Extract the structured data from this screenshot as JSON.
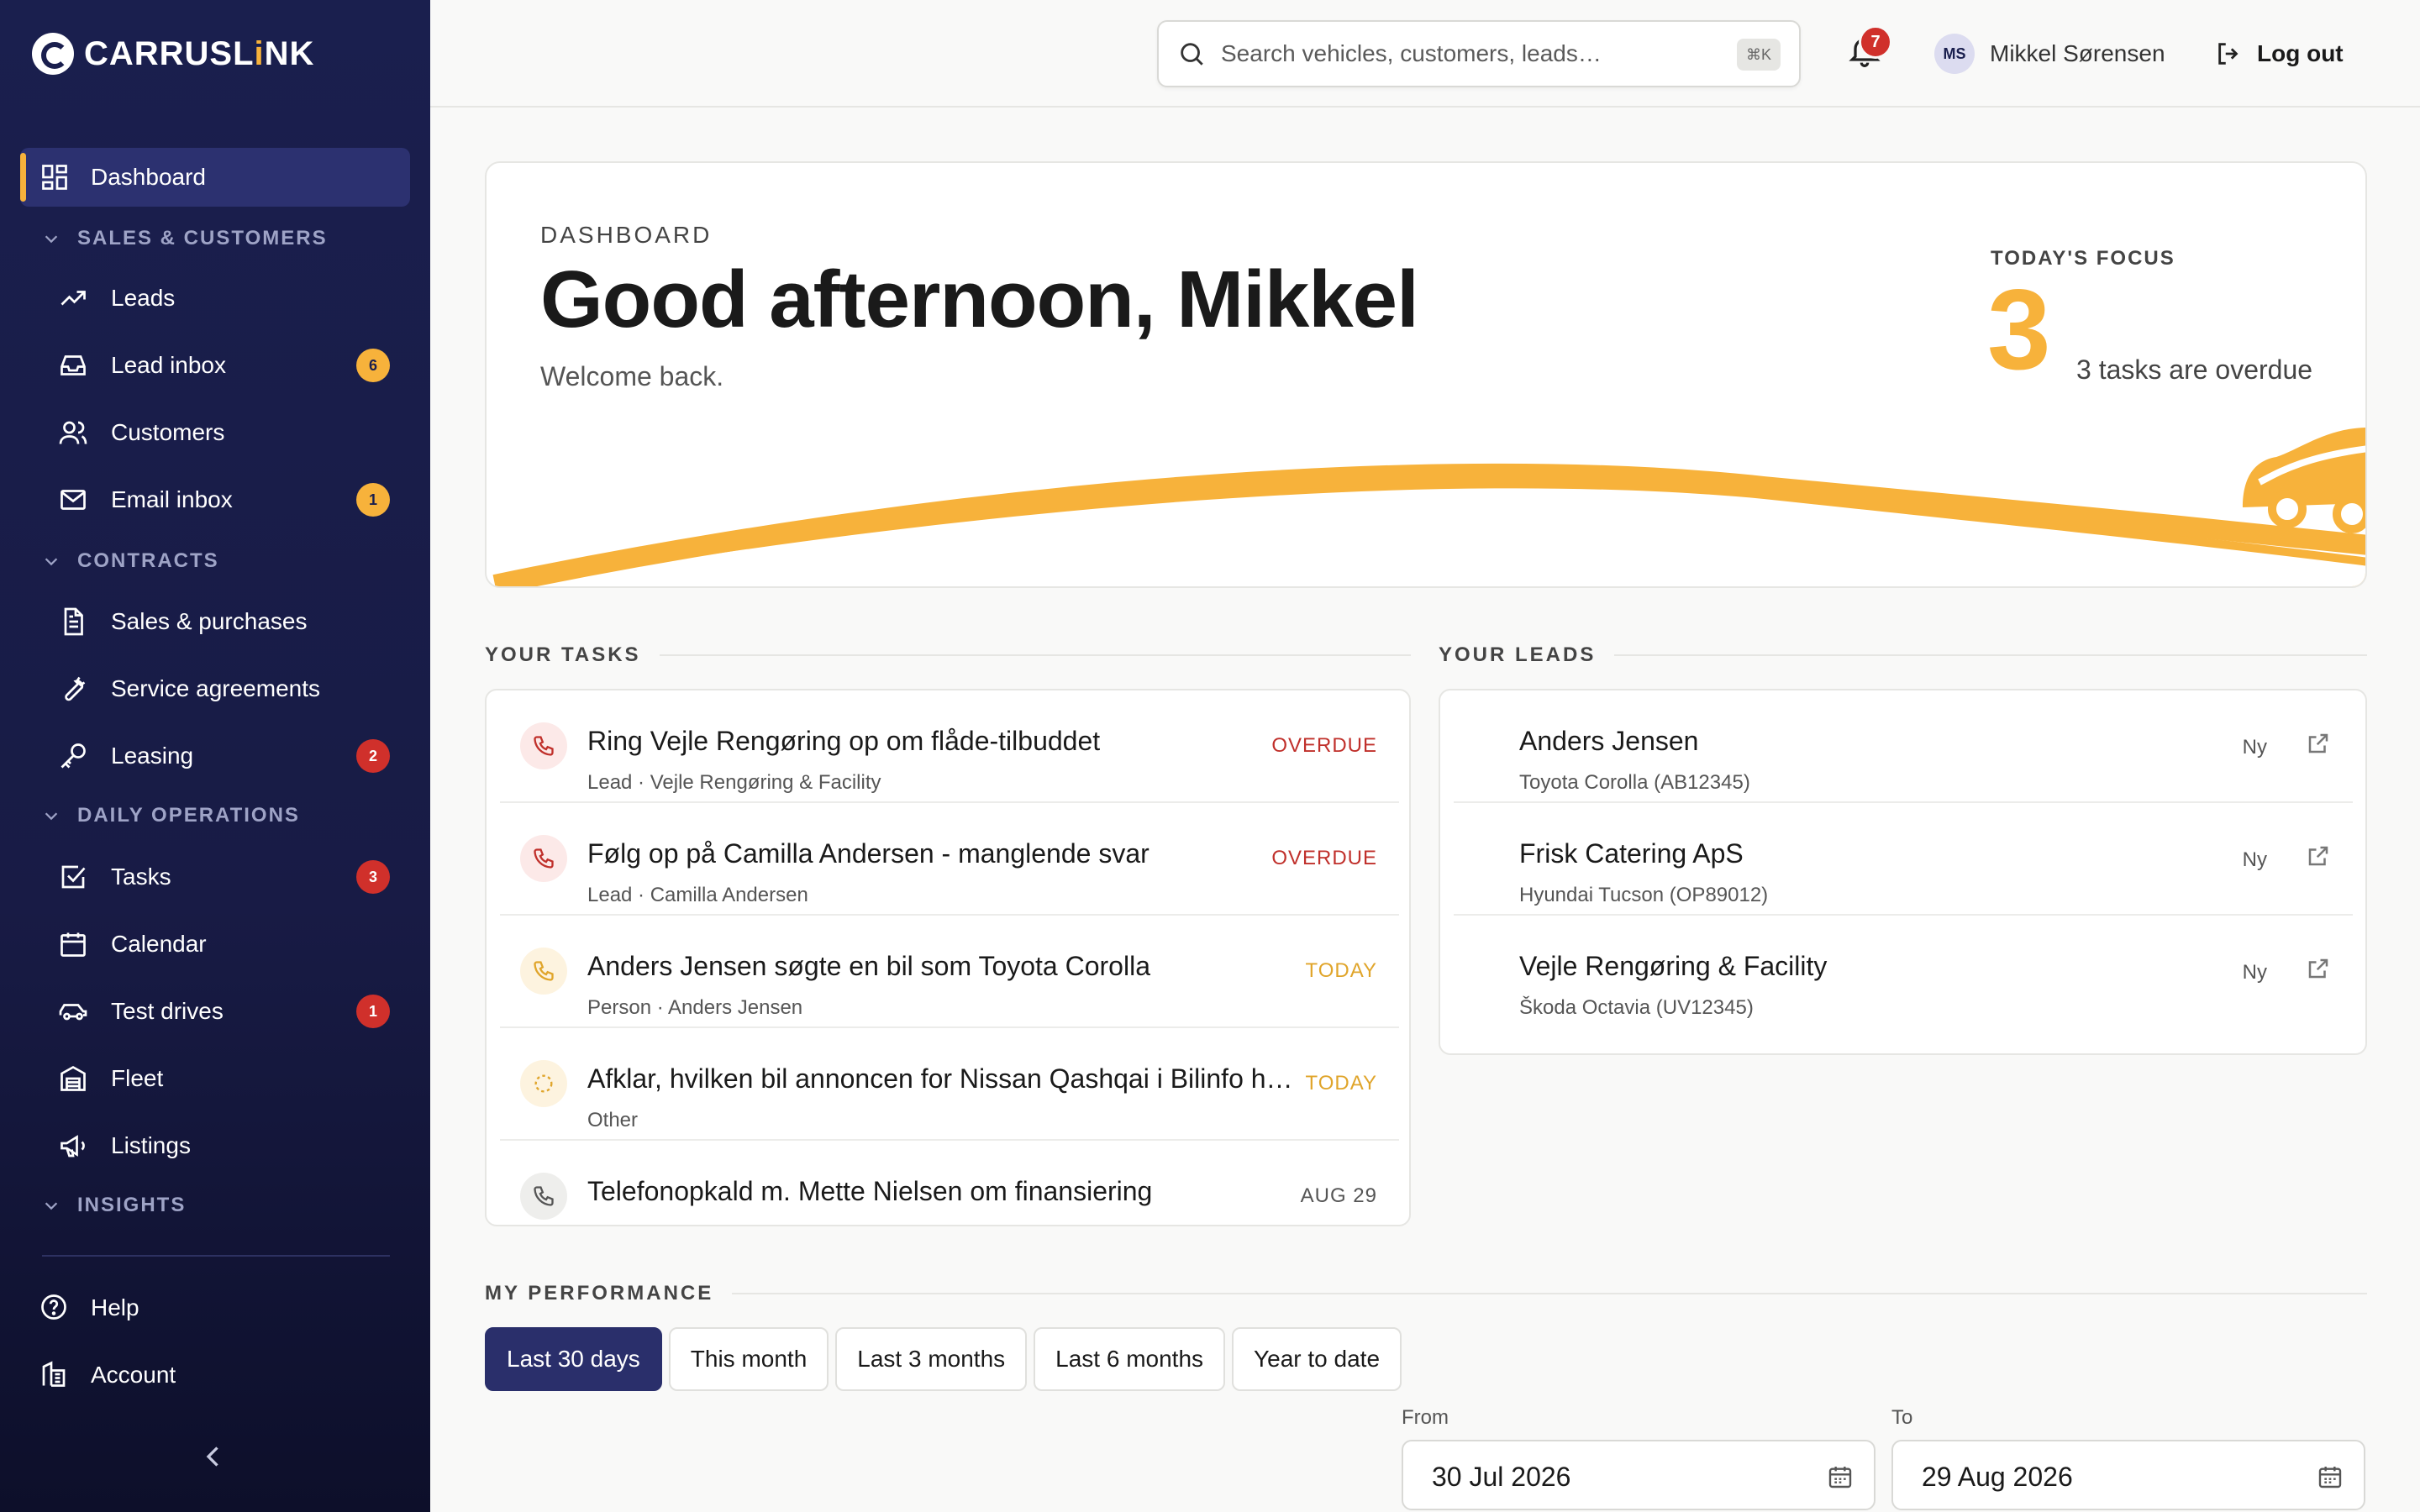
{
  "brand": {
    "name_prefix": "CARRUSL",
    "name_i": "i",
    "name_suffix": "NK"
  },
  "sidebar": {
    "dashboard": "Dashboard",
    "sections": {
      "sales": "SALES & CUSTOMERS",
      "contracts": "CONTRACTS",
      "daily": "DAILY OPERATIONS",
      "insights": "INSIGHTS"
    },
    "items": {
      "leads": "Leads",
      "lead_inbox": "Lead inbox",
      "lead_inbox_badge": "6",
      "customers": "Customers",
      "email_inbox": "Email inbox",
      "email_inbox_badge": "1",
      "sales_purchases": "Sales & purchases",
      "service_agreements": "Service agreements",
      "leasing": "Leasing",
      "leasing_badge": "2",
      "tasks": "Tasks",
      "tasks_badge": "3",
      "calendar": "Calendar",
      "test_drives": "Test drives",
      "test_drives_badge": "1",
      "fleet": "Fleet",
      "listings": "Listings"
    },
    "help": "Help",
    "account": "Account"
  },
  "topbar": {
    "search_placeholder": "Search vehicles, customers, leads…",
    "search_shortcut": "⌘K",
    "notifications_count": "7",
    "user_initials": "MS",
    "user_name": "Mikkel Sørensen",
    "logout": "Log out"
  },
  "hero": {
    "eyebrow": "DASHBOARD",
    "title": "Good afternoon, Mikkel",
    "subtitle": "Welcome back.",
    "focus_label": "TODAY'S FOCUS",
    "focus_count": "3",
    "focus_text": "3 tasks are overdue"
  },
  "tasks": {
    "heading": "YOUR TASKS",
    "items": [
      {
        "title": "Ring Vejle Rengøring op om flåde-tilbuddet",
        "sub": "Lead · Vejle Rengøring & Facility",
        "status": "OVERDUE"
      },
      {
        "title": "Følg op på Camilla Andersen - manglende svar",
        "sub": "Lead · Camilla Andersen",
        "status": "OVERDUE"
      },
      {
        "title": "Anders Jensen søgte en bil som Toyota Corolla",
        "sub": "Person · Anders Jensen",
        "status": "TODAY"
      },
      {
        "title": "Afklar, hvilken bil annoncen for Nissan Qashqai i Bilinfo h…",
        "sub": "Other",
        "status": "TODAY"
      },
      {
        "title": "Telefonopkald m. Mette Nielsen om finansiering",
        "sub": "",
        "status": "AUG 29"
      }
    ]
  },
  "leads": {
    "heading": "YOUR LEADS",
    "items": [
      {
        "name": "Anders Jensen",
        "vehicle": "Toyota Corolla (AB12345)",
        "status": "Ny"
      },
      {
        "name": "Frisk Catering ApS",
        "vehicle": "Hyundai Tucson (OP89012)",
        "status": "Ny"
      },
      {
        "name": "Vejle Rengøring & Facility",
        "vehicle": "Škoda Octavia (UV12345)",
        "status": "Ny"
      }
    ]
  },
  "performance": {
    "heading": "MY PERFORMANCE",
    "periods": [
      "Last 30 days",
      "This month",
      "Last 3 months",
      "Last 6 months",
      "Year to date"
    ],
    "from_label": "From",
    "from_value": "30 Jul 2026",
    "to_label": "To",
    "to_value": "29 Aug 2026"
  },
  "colors": {
    "sidebar": "#1a1f4e",
    "accent": "#f7b23b",
    "danger": "#d0302b",
    "active_period": "#2a2f6b"
  }
}
